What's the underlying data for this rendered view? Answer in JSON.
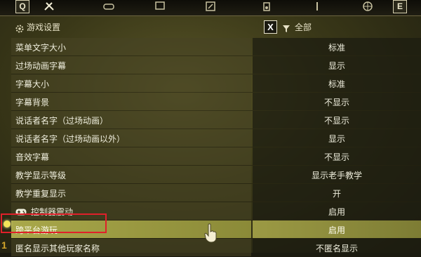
{
  "topbar": {
    "left_key": "Q",
    "right_key": "E"
  },
  "header": {
    "title": "游戏设置",
    "filter_key": "X",
    "filter_label": "全部"
  },
  "settings": [
    {
      "label": "菜单文字大小",
      "value": "标准"
    },
    {
      "label": "过场动画字幕",
      "value": "显示"
    },
    {
      "label": "字幕大小",
      "value": "标准"
    },
    {
      "label": "字幕背景",
      "value": "不显示"
    },
    {
      "label": "说话者名字（过场动画）",
      "value": "不显示"
    },
    {
      "label": "说话者名字（过场动画以外）",
      "value": "显示"
    },
    {
      "label": "音效字幕",
      "value": "不显示"
    },
    {
      "label": "教学显示等级",
      "value": "显示老手教学"
    },
    {
      "label": "教学重复显示",
      "value": "开"
    },
    {
      "label": "控制器震动",
      "value": "启用"
    },
    {
      "label": "跨平台游玩",
      "value": "启用"
    },
    {
      "label": "匿名显示其他玩家名称",
      "value": "不匿名显示"
    }
  ],
  "watermark": "1"
}
